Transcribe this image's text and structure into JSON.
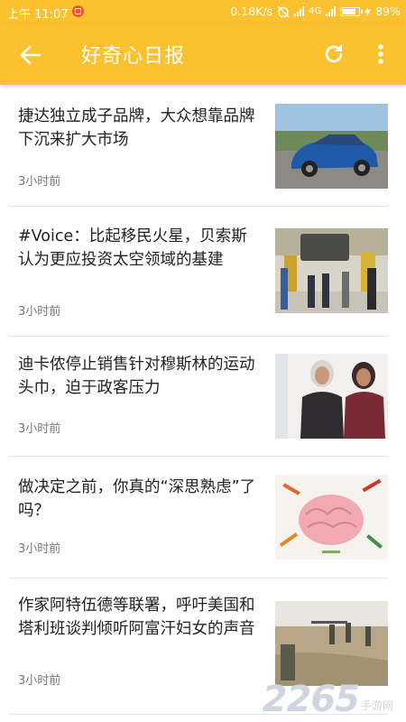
{
  "status_bar": {
    "time": "上午 11:07",
    "speed": "0.18K/s",
    "network": "4G",
    "battery": "89%",
    "battery_level": 0.89
  },
  "toolbar": {
    "title": "好奇心日报",
    "back_icon": "back-arrow-icon",
    "refresh_icon": "refresh-icon",
    "more_icon": "more-vert-icon"
  },
  "articles": [
    {
      "title": "捷达独立成子品牌，大众想靠品牌下沉来扩大市场",
      "time": "3小时前"
    },
    {
      "title": "#Voice：比起移民火星，贝索斯认为更应投资太空领域的基建",
      "time": "3小时前"
    },
    {
      "title": "迪卡侬停止销售针对穆斯林的运动头巾，迫于政客压力",
      "time": "3小时前"
    },
    {
      "title": "做决定之前，你真的“深思熟虑”了吗？",
      "time": "3小时前"
    },
    {
      "title": "作家阿特伍德等联署，呼吁美国和塔利班谈判倾听阿富汗妇女的声音",
      "time": "3小时前"
    }
  ],
  "watermark": {
    "number": "2265",
    "suffix": "手游网"
  },
  "colors": {
    "accent": "#fcc12e",
    "text": "#222222",
    "secondary": "#777777"
  }
}
